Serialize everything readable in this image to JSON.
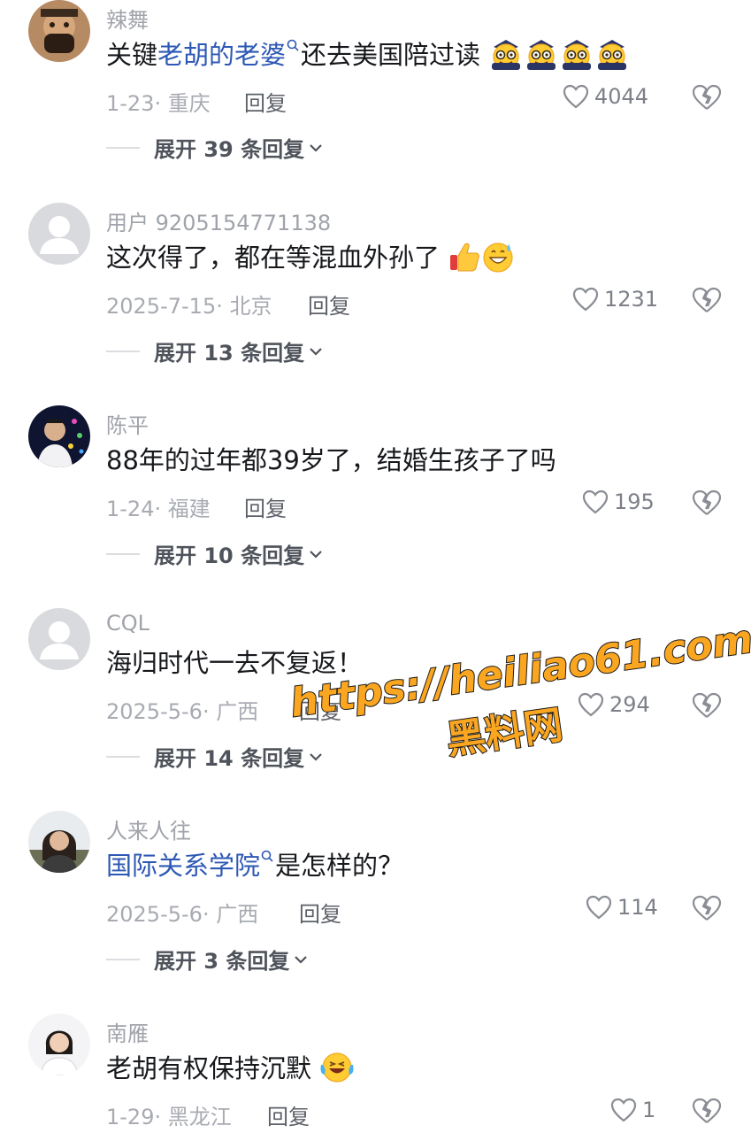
{
  "reply_label": "回复",
  "comments": [
    {
      "username": "辣舞",
      "segments": [
        {
          "text": "关键",
          "link": false
        },
        {
          "text": "老胡的老婆",
          "link": true
        },
        {
          "text": "还去美国陪过读",
          "link": false
        }
      ],
      "emoji_count": 4,
      "emoji_name": "nerd-face-emoji",
      "date_location": "1-23· 重庆",
      "likes": "4044",
      "expand": "展开 39 条回复"
    },
    {
      "username": "用户 9205154771138",
      "text": "这次得了，都在等混血外孙了",
      "emojis": [
        "thumbs-up-emoji",
        "grinning-sweat-emoji"
      ],
      "date_location": "2025-7-15· 北京",
      "likes": "1231",
      "expand": "展开 13 条回复"
    },
    {
      "username": "陈平",
      "text": "88年的过年都39岁了，结婚生孩子了吗",
      "date_location": "1-24· 福建",
      "likes": "195",
      "expand": "展开 10 条回复"
    },
    {
      "username": "CQL",
      "text": "海归时代一去不复返！",
      "date_location": "2025-5-6· 广西",
      "likes": "294",
      "expand": "展开 14 条回复"
    },
    {
      "username": "人来人往",
      "segments": [
        {
          "text": "国际关系学院",
          "link": true
        },
        {
          "text": "是怎样的？",
          "link": false
        }
      ],
      "date_location": "2025-5-6· 广西",
      "likes": "114",
      "expand": "展开 3 条回复"
    },
    {
      "username": "南雁",
      "text": "老胡有权保持沉默",
      "emojis": [
        "crying-laughing-emoji"
      ],
      "date_location": "1-29· 黑龙江",
      "likes": "1"
    }
  ],
  "watermark": {
    "url": "https://heiliao61.com",
    "name": "黑料网"
  },
  "colors": {
    "link": "#2d58b4",
    "text": "#16181c",
    "muted": "#a0a3aa",
    "watermark": "#fba621"
  }
}
